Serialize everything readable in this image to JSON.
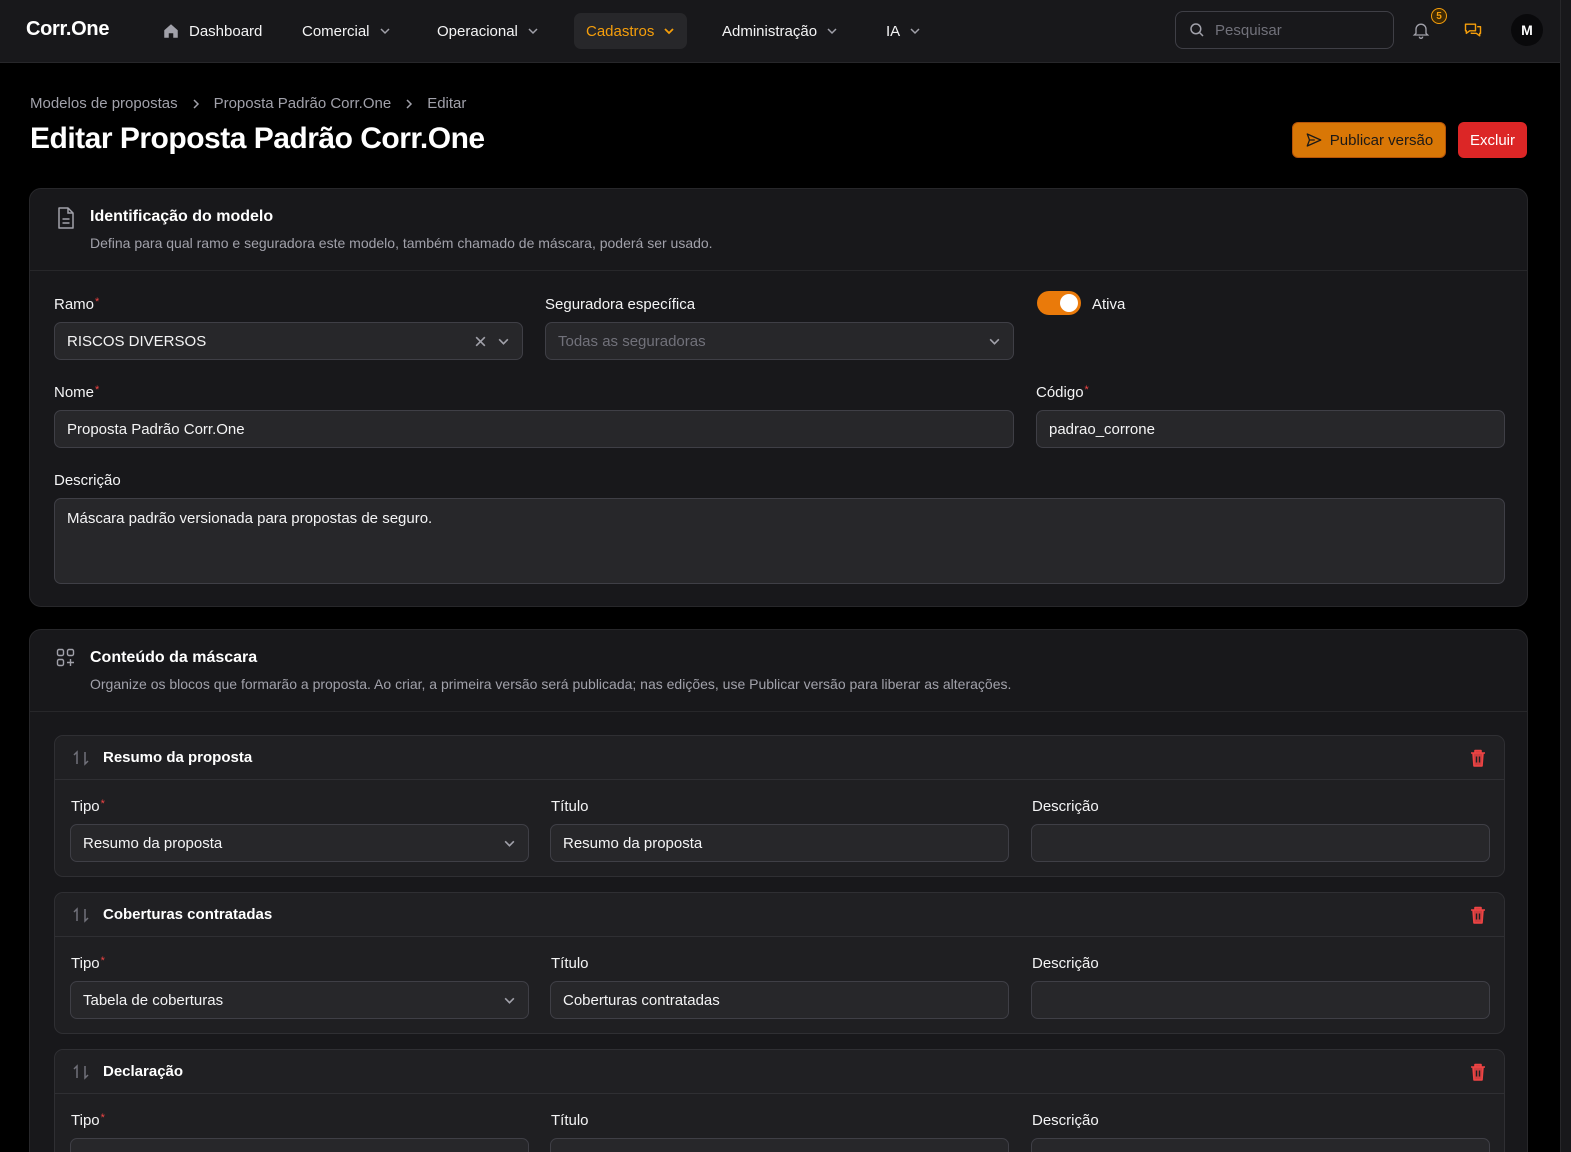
{
  "brand": "Corr.One",
  "nav": {
    "dashboard": "Dashboard",
    "comercial": "Comercial",
    "operacional": "Operacional",
    "cadastros": "Cadastros",
    "administracao": "Administração",
    "ia": "IA"
  },
  "search": {
    "placeholder": "Pesquisar"
  },
  "notifications": {
    "count": "5"
  },
  "user": {
    "initial": "M"
  },
  "breadcrumb": [
    "Modelos de propostas",
    "Proposta Padrão Corr.One",
    "Editar"
  ],
  "page": {
    "title": "Editar Proposta Padrão Corr.One",
    "publish_label": "Publicar versão",
    "delete_label": "Excluir"
  },
  "identificacao": {
    "title": "Identificação do modelo",
    "description": "Defina para qual ramo e seguradora este modelo, também chamado de máscara, poderá ser usado.",
    "ramo_label": "Ramo",
    "ramo_value": "RISCOS DIVERSOS",
    "seguradora_label": "Seguradora específica",
    "seguradora_placeholder": "Todas as seguradoras",
    "ativa_label": "Ativa",
    "ativa_on": true,
    "nome_label": "Nome",
    "nome_value": "Proposta Padrão Corr.One",
    "codigo_label": "Código",
    "codigo_value": "padrao_corrone",
    "descricao_label": "Descrição",
    "descricao_value": "Máscara padrão versionada para propostas de seguro."
  },
  "conteudo": {
    "title": "Conteúdo da máscara",
    "description": "Organize os blocos que formarão a proposta. Ao criar, a primeira versão será publicada; nas edições, use Publicar versão para liberar as alterações.",
    "tipo_label": "Tipo",
    "titulo_label": "Título",
    "descricao_label": "Descrição",
    "blocks": [
      {
        "header": "Resumo da proposta",
        "tipo": "Resumo da proposta",
        "titulo": "Resumo da proposta",
        "descricao": ""
      },
      {
        "header": "Coberturas contratadas",
        "tipo": "Tabela de coberturas",
        "titulo": "Coberturas contratadas",
        "descricao": ""
      },
      {
        "header": "Declaração",
        "tipo": "",
        "titulo": "",
        "descricao": ""
      }
    ]
  },
  "colors": {
    "accent": "#f59e0b",
    "publish": "#d97706",
    "danger": "#dc2626",
    "toggle": "#ea7a0a"
  }
}
